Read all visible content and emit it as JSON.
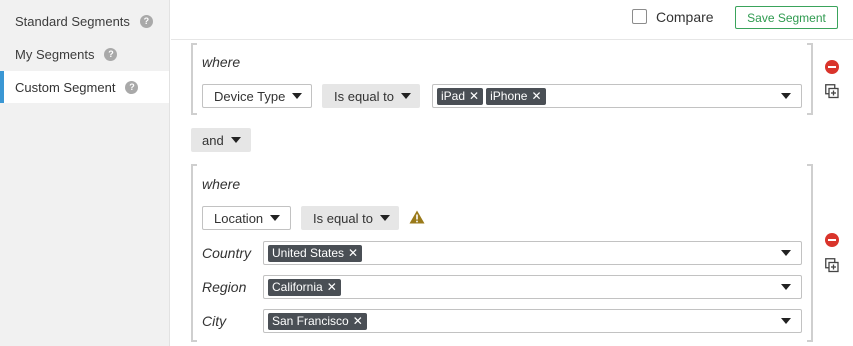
{
  "sidebar": {
    "items": [
      {
        "label": "Standard Segments",
        "help": "?"
      },
      {
        "label": "My Segments",
        "help": "?"
      },
      {
        "label": "Custom Segment",
        "help": "?"
      }
    ]
  },
  "toolbar": {
    "compare_label": "Compare",
    "save_label": "Save Segment"
  },
  "group1": {
    "where_label": "where",
    "dimension": "Device Type",
    "operator": "Is equal to",
    "values": [
      "iPad",
      "iPhone"
    ]
  },
  "connector": {
    "label": "and"
  },
  "group2": {
    "where_label": "where",
    "dimension": "Location",
    "operator": "Is equal to",
    "fields": [
      {
        "label": "Country",
        "values": [
          "United States"
        ]
      },
      {
        "label": "Region",
        "values": [
          "California"
        ]
      },
      {
        "label": "City",
        "values": [
          "San Francisco"
        ]
      }
    ]
  },
  "colors": {
    "accent_blue": "#3a97d4",
    "save_green": "#2e9a4f",
    "remove_red": "#d9342b",
    "warning": "#9a7a1a",
    "tag_bg": "#4a4f55"
  },
  "tag_remove_glyph": "✕"
}
